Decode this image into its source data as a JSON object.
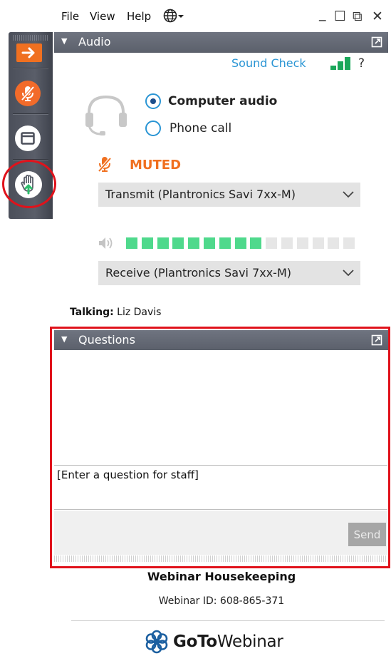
{
  "menu": {
    "file": "File",
    "view": "View",
    "help": "Help"
  },
  "window_controls": {
    "minimize": "_",
    "maximize": "☐",
    "restore": "⧉",
    "close": "✕"
  },
  "side_toolbar": {
    "items": [
      {
        "icon": "arrow-right-icon",
        "color": "#f07020"
      },
      {
        "icon": "muted-mic-icon",
        "color": "#f26b2a"
      },
      {
        "icon": "window-icon",
        "color": "#ffffff"
      },
      {
        "icon": "raise-hand-icon",
        "color": "#ffffff"
      }
    ]
  },
  "audio": {
    "title": "Audio",
    "sound_check": "Sound Check",
    "help": "?",
    "options": [
      {
        "label": "Computer audio",
        "selected": true
      },
      {
        "label": "Phone call",
        "selected": false
      }
    ],
    "muted_label": "MUTED",
    "transmit": "Transmit (Plantronics Savi 7xx-M)",
    "receive": "Receive (Plantronics Savi 7xx-M)",
    "level_active": 9,
    "level_total": 15,
    "level_color": "#4fd98c",
    "talking_label": "Talking:",
    "talking_name": "Liz Davis"
  },
  "questions": {
    "title": "Questions",
    "input_placeholder": "[Enter a question for staff]",
    "send": "Send"
  },
  "footer": {
    "webinar_title": "Webinar Housekeeping",
    "webinar_id": "Webinar ID: 608-865-371",
    "brand_bold": "GoTo",
    "brand_light": "Webinar"
  },
  "colors": {
    "accent": "#2a95d4",
    "muted": "#f07020",
    "highlight": "#e0121b",
    "header": "#636873"
  }
}
